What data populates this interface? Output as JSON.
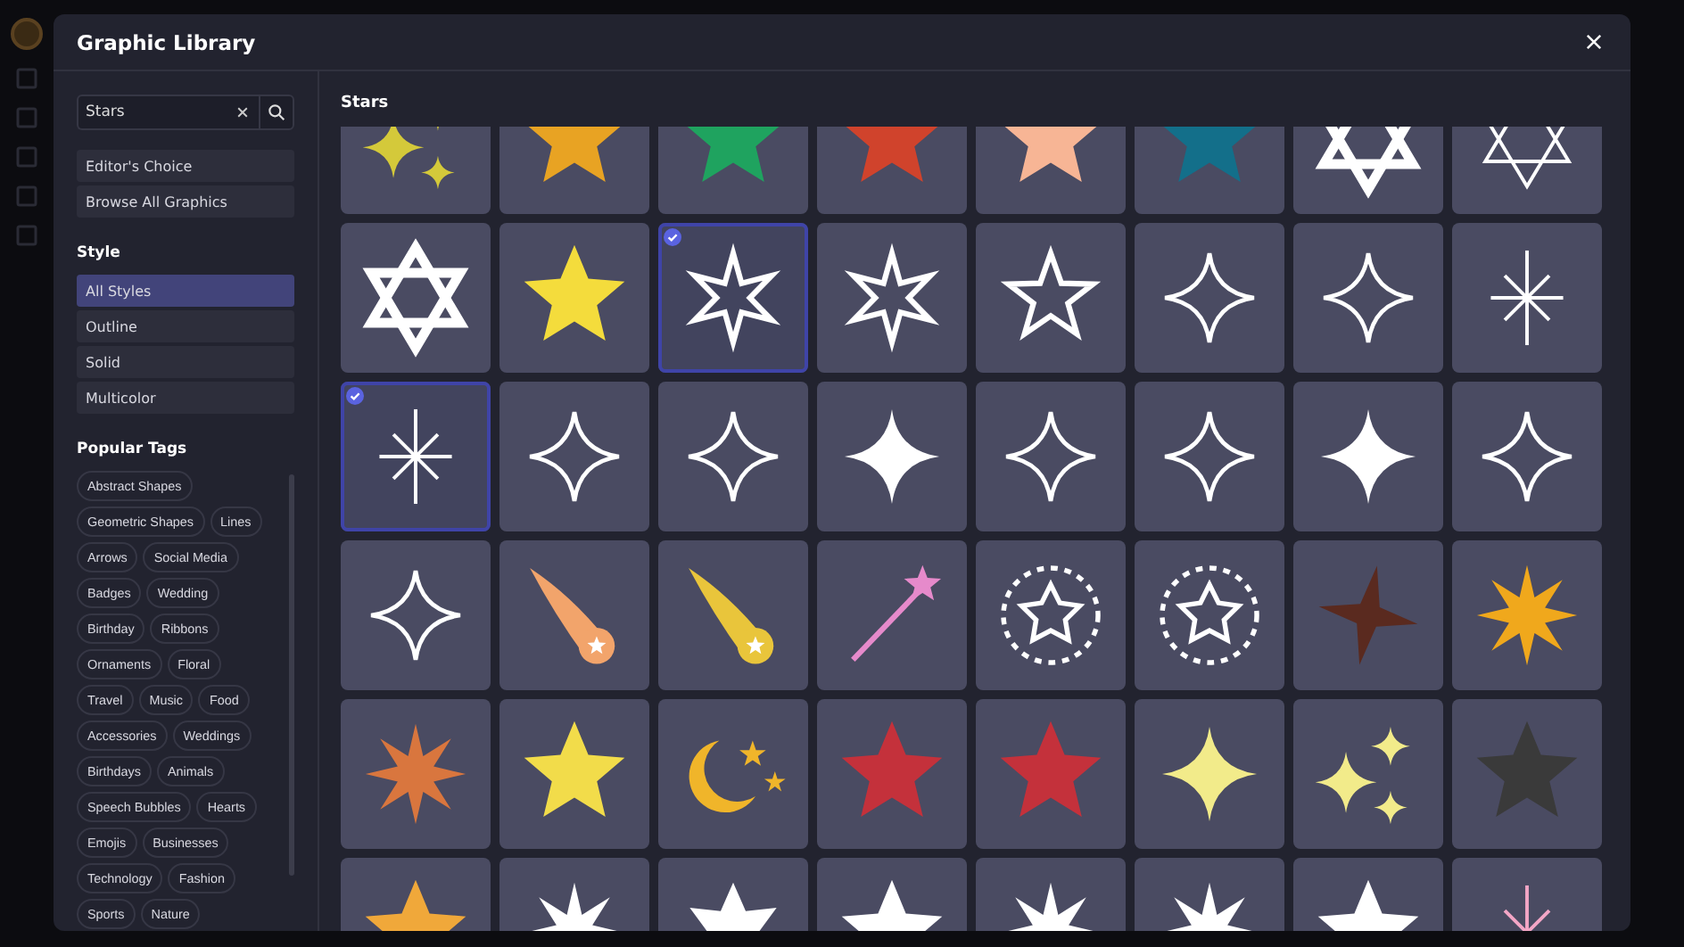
{
  "dialog": {
    "title": "Graphic Library"
  },
  "search": {
    "value": "Stars"
  },
  "collections": [
    {
      "label": "Editor's Choice",
      "selected": false
    },
    {
      "label": "Browse All Graphics",
      "selected": false
    }
  ],
  "style_section": {
    "title": "Style",
    "options": [
      {
        "label": "All Styles",
        "selected": true
      },
      {
        "label": "Outline",
        "selected": false
      },
      {
        "label": "Solid",
        "selected": false
      },
      {
        "label": "Multicolor",
        "selected": false
      }
    ]
  },
  "tags_section": {
    "title": "Popular Tags",
    "tags": [
      "Abstract Shapes",
      "Geometric Shapes",
      "Lines",
      "Arrows",
      "Social Media",
      "Badges",
      "Wedding",
      "Birthday",
      "Ribbons",
      "Ornaments",
      "Floral",
      "Travel",
      "Music",
      "Food",
      "Accessories",
      "Weddings",
      "Birthdays",
      "Animals",
      "Speech Bubbles",
      "Hearts",
      "Emojis",
      "Businesses",
      "Technology",
      "Fashion",
      "Sports",
      "Nature"
    ]
  },
  "results": {
    "title": "Stars",
    "tiles": [
      {
        "kind": "sparkles",
        "color": "#d4c93a",
        "selected": false
      },
      {
        "kind": "star5",
        "color": "#e8a323",
        "selected": false
      },
      {
        "kind": "star5",
        "color": "#1fa35f",
        "selected": false
      },
      {
        "kind": "star5",
        "color": "#d0432c",
        "selected": false
      },
      {
        "kind": "star5",
        "color": "#f7b595",
        "selected": false
      },
      {
        "kind": "star5",
        "color": "#136f8a",
        "selected": false
      },
      {
        "kind": "hexagram",
        "color": "#ffffff",
        "selected": false
      },
      {
        "kind": "hexagram-outline",
        "color": "#ffffff",
        "selected": false
      },
      {
        "kind": "hexagram",
        "color": "#ffffff",
        "selected": false
      },
      {
        "kind": "star5",
        "color": "#f4dc3c",
        "selected": false
      },
      {
        "kind": "star6-outline",
        "color": "#ffffff",
        "selected": true
      },
      {
        "kind": "star6-outline",
        "color": "#ffffff",
        "selected": false
      },
      {
        "kind": "star5-outline",
        "color": "#ffffff",
        "selected": false
      },
      {
        "kind": "sparkle-outline",
        "color": "#ffffff",
        "selected": false
      },
      {
        "kind": "sparkle-outline",
        "color": "#ffffff",
        "selected": false
      },
      {
        "kind": "asterisk",
        "color": "#ffffff",
        "selected": false
      },
      {
        "kind": "asterisk",
        "color": "#ffffff",
        "selected": true
      },
      {
        "kind": "sparkle-outline",
        "color": "#ffffff",
        "selected": false
      },
      {
        "kind": "sparkle-outline",
        "color": "#ffffff",
        "selected": false
      },
      {
        "kind": "sparkle",
        "color": "#ffffff",
        "selected": false
      },
      {
        "kind": "sparkle-outline",
        "color": "#ffffff",
        "selected": false
      },
      {
        "kind": "sparkle-outline",
        "color": "#ffffff",
        "selected": false
      },
      {
        "kind": "sparkle",
        "color": "#ffffff",
        "selected": false
      },
      {
        "kind": "sparkle-outline",
        "color": "#ffffff",
        "selected": false
      },
      {
        "kind": "sparkle-outline",
        "color": "#ffffff",
        "selected": false
      },
      {
        "kind": "comet",
        "color": "#f2a46b",
        "selected": false
      },
      {
        "kind": "comet",
        "color": "#e9c53b",
        "selected": false
      },
      {
        "kind": "wand",
        "color": "#e68acb",
        "selected": false
      },
      {
        "kind": "burst",
        "color": "#ffffff",
        "selected": false
      },
      {
        "kind": "burst",
        "color": "#ffffff",
        "selected": false
      },
      {
        "kind": "star4",
        "color": "#5a2a1f",
        "selected": false
      },
      {
        "kind": "star8",
        "color": "#f0a81c",
        "selected": false
      },
      {
        "kind": "star8",
        "color": "#d9763e",
        "selected": false
      },
      {
        "kind": "star5",
        "color": "#f2dc4a",
        "selected": false
      },
      {
        "kind": "moon",
        "color": "#f0b52a",
        "selected": false
      },
      {
        "kind": "star5",
        "color": "#c4313b",
        "selected": false
      },
      {
        "kind": "star5",
        "color": "#c4313b",
        "selected": false
      },
      {
        "kind": "sparkle",
        "color": "#f2eb8a",
        "selected": false
      },
      {
        "kind": "sparkles",
        "color": "#f2eb8a",
        "selected": false
      },
      {
        "kind": "star5",
        "color": "#3a3a3a",
        "selected": false
      },
      {
        "kind": "star5",
        "color": "#f0a83a",
        "selected": false
      },
      {
        "kind": "star8",
        "color": "#ffffff",
        "selected": false
      },
      {
        "kind": "star6",
        "color": "#ffffff",
        "selected": false
      },
      {
        "kind": "star5",
        "color": "#ffffff",
        "selected": false
      },
      {
        "kind": "star8",
        "color": "#ffffff",
        "selected": false
      },
      {
        "kind": "star8",
        "color": "#ffffff",
        "selected": false
      },
      {
        "kind": "star5",
        "color": "#ffffff",
        "selected": false
      },
      {
        "kind": "asterisk",
        "color": "#f3a6c6",
        "selected": false
      }
    ]
  }
}
